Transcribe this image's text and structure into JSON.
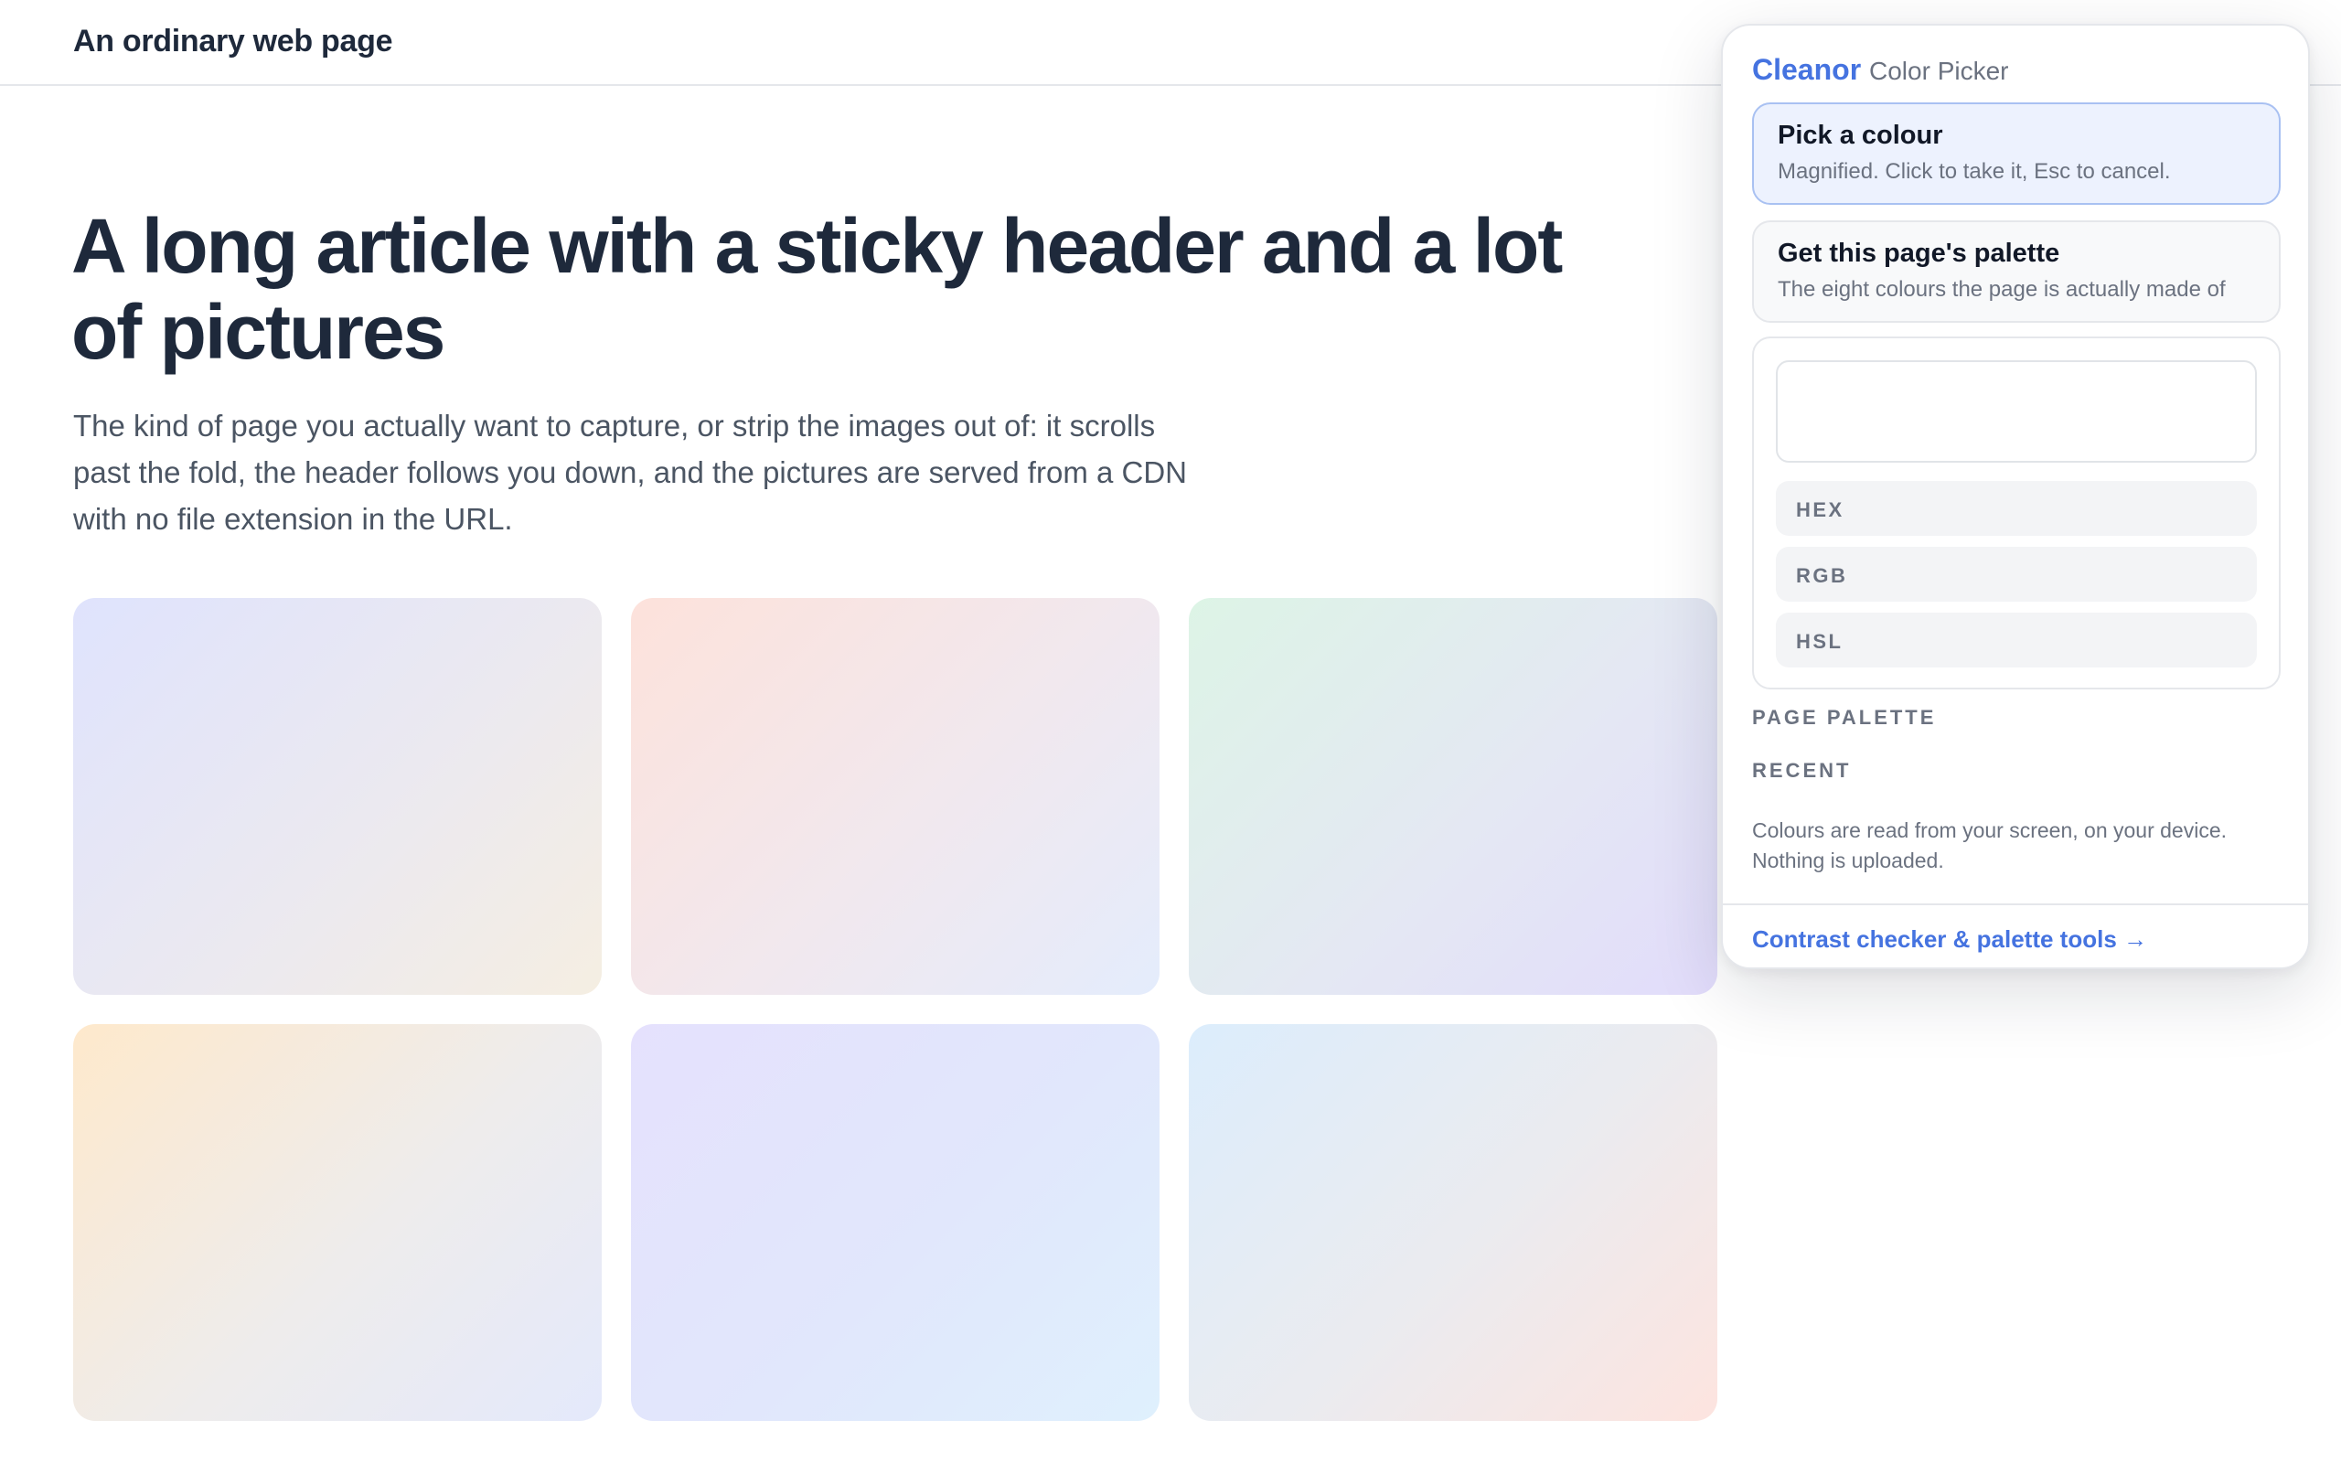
{
  "site": {
    "title": "An ordinary web page"
  },
  "article": {
    "title": "A long article with a sticky header and a lot of pictures",
    "intro": "The kind of page you actually want to capture, or strip the images out of: it scrolls past the fold, the header follows you down, and the pictures are served from a CDN with no file extension in the URL.",
    "images": 6
  },
  "extension": {
    "brand": "Cleanor",
    "subtitle": "Color Picker",
    "brand_color": "#4573e0",
    "pick": {
      "title": "Pick a colour",
      "description": "Magnified. Click to take it, Esc to cancel."
    },
    "palette_action": {
      "title": "Get this page's palette",
      "description": "The eight colours the page is actually made of"
    },
    "formats": {
      "hex": "HEX",
      "rgb": "RGB",
      "hsl": "HSL"
    },
    "sections": {
      "page_palette": "PAGE PALETTE",
      "recent": "RECENT"
    },
    "privacy_note": "Colours are read from your screen, on your device. Nothing is uploaded.",
    "footer_link": "Contrast checker & palette tools →"
  }
}
